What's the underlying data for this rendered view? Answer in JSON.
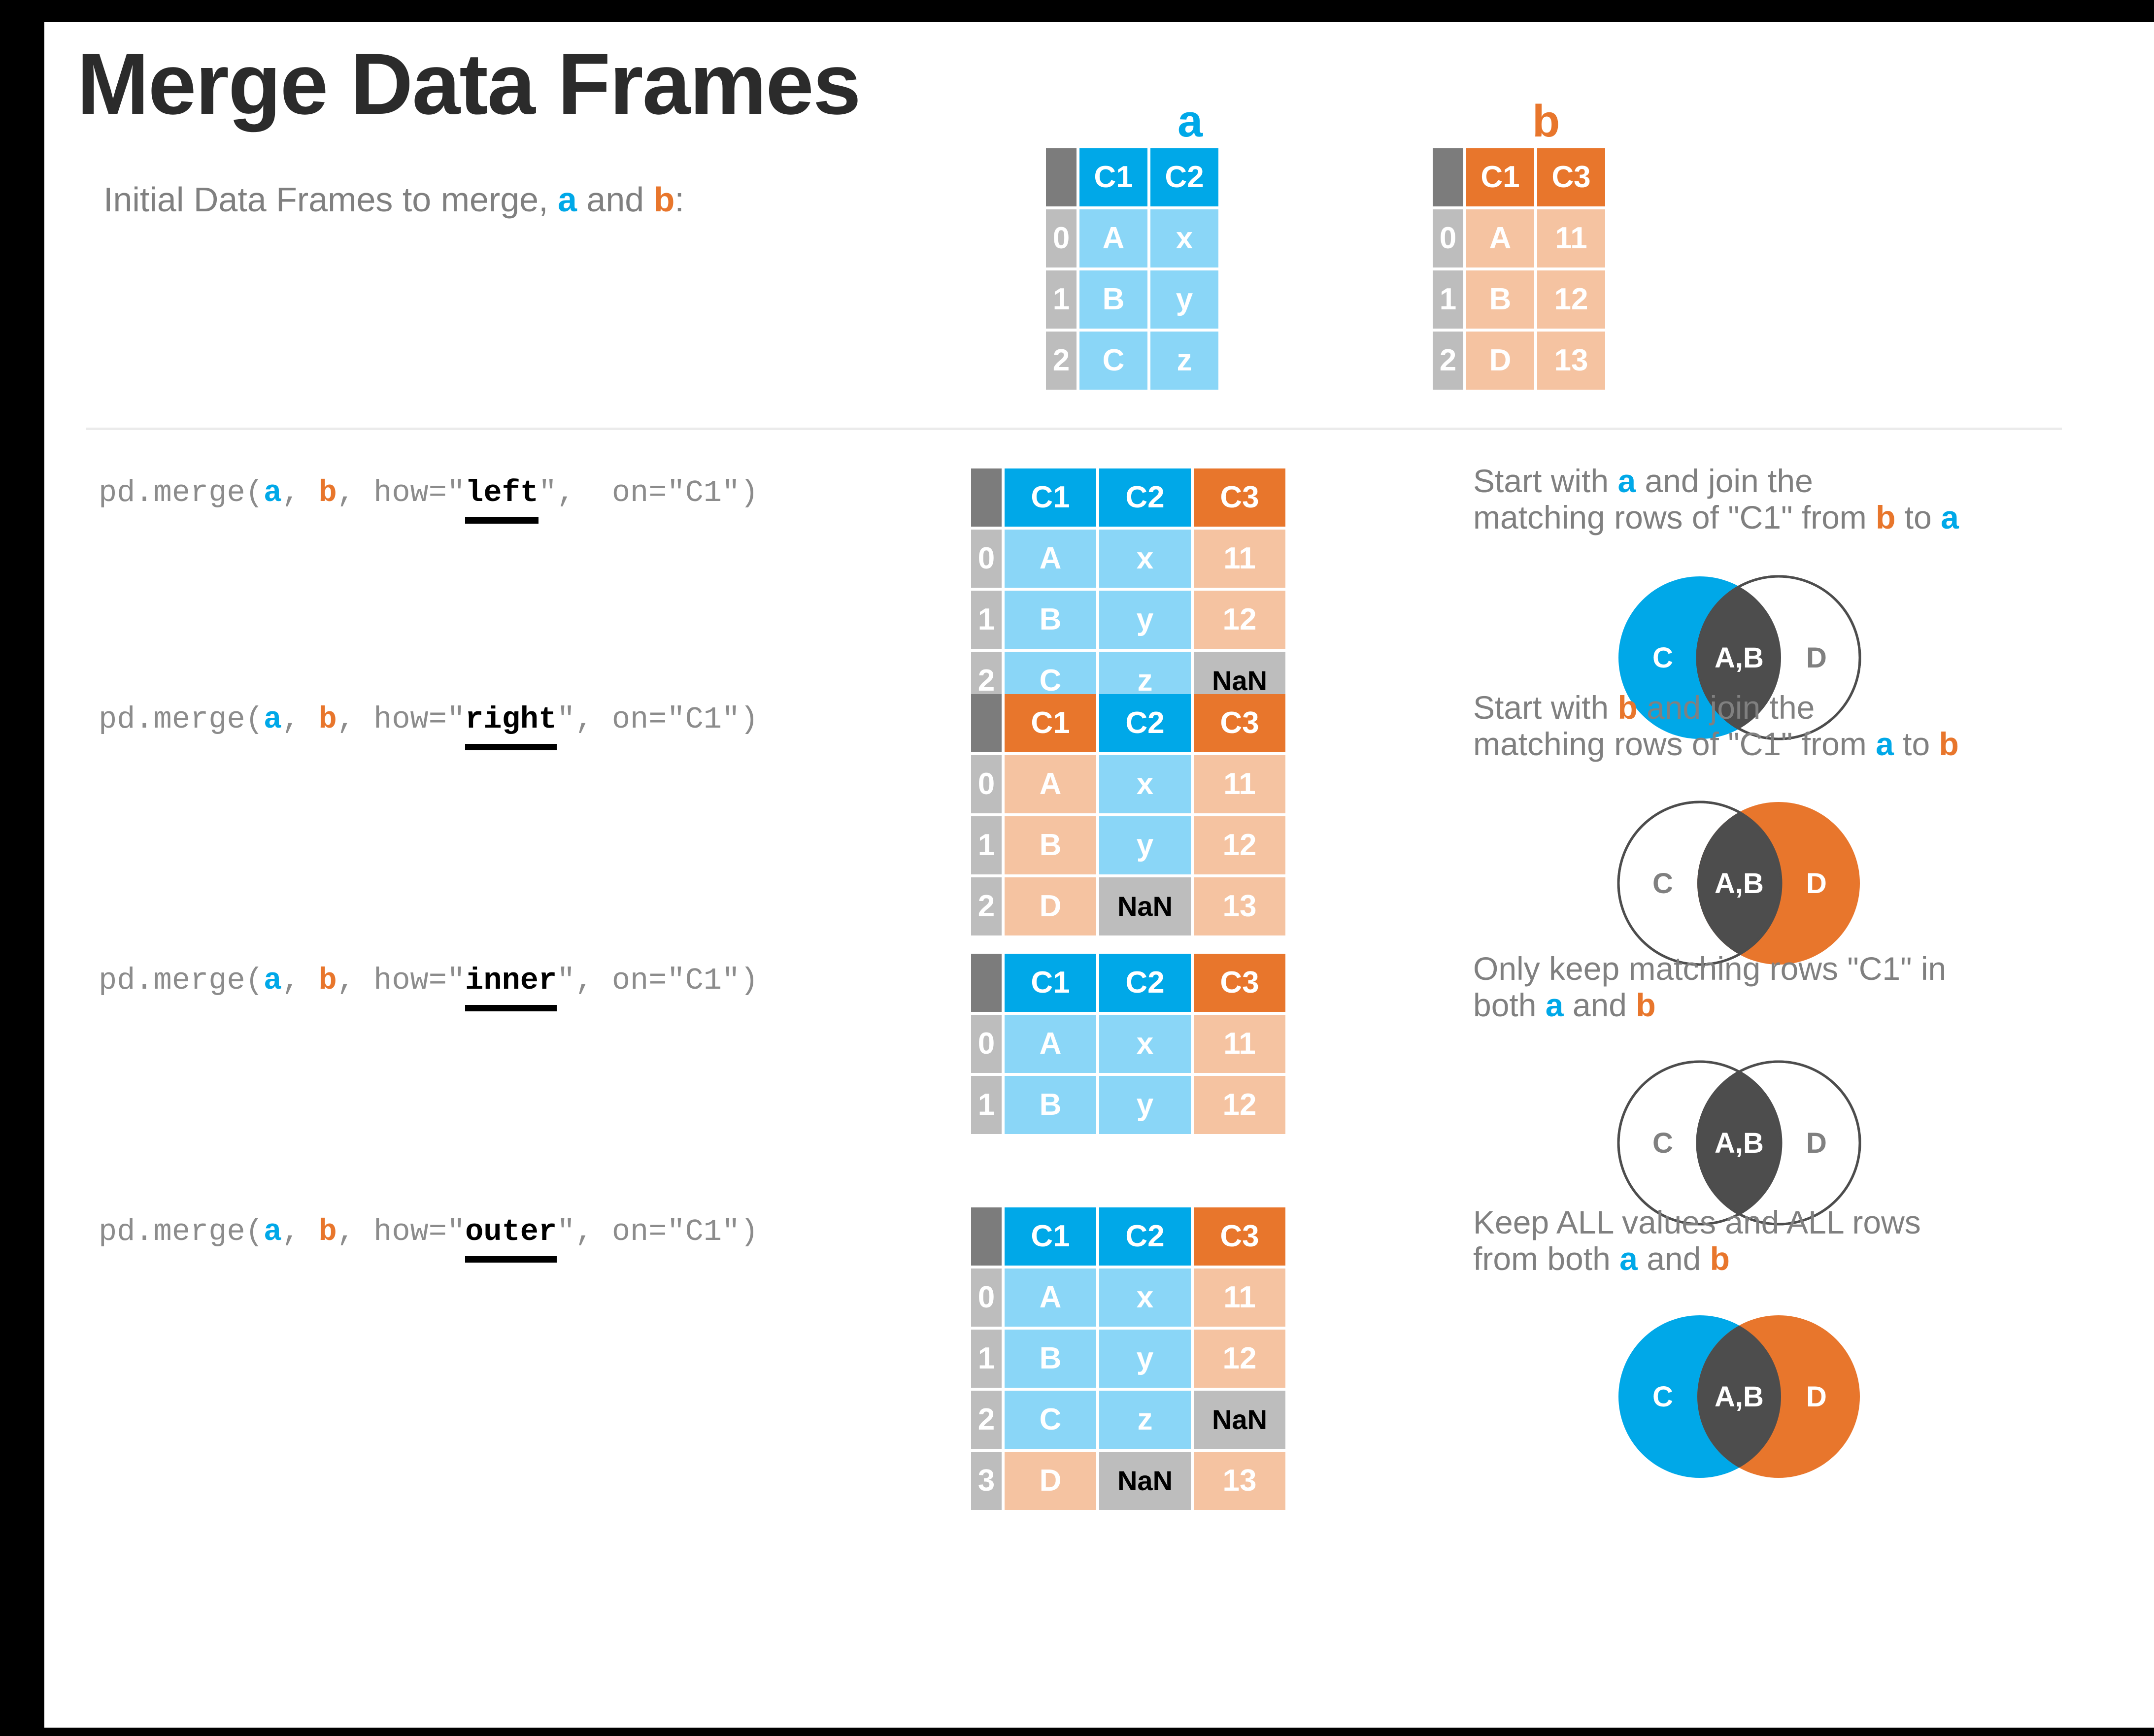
{
  "page": {
    "title": "Merge Data Frames",
    "intro_prefix": "Initial Data Frames to merge, ",
    "intro_a": "a",
    "intro_and": " and ",
    "intro_b": "b",
    "intro_suffix": ":"
  },
  "colors": {
    "blue": "#00a8e8",
    "blue_light": "#8ad6f7",
    "orange": "#e8762c",
    "orange_light": "#f5c3a1",
    "index_header": "#7c7c7c",
    "index_cell": "#bdbdbd",
    "nan_cell": "#bdbdbd",
    "dark_gray": "#4d4d4d",
    "text_gray": "#808080",
    "title_dark": "#2b2b2b"
  },
  "captions": {
    "a": "a",
    "b": "b"
  },
  "tables": {
    "a": {
      "name": "a",
      "headers": [
        "",
        "C1",
        "C2"
      ],
      "header_styles": [
        "idxh",
        "hb",
        "hb"
      ],
      "rows": [
        {
          "index": "0",
          "cells": [
            "A",
            "x"
          ],
          "styles": [
            "vb",
            "vb"
          ]
        },
        {
          "index": "1",
          "cells": [
            "B",
            "y"
          ],
          "styles": [
            "vb",
            "vb"
          ]
        },
        {
          "index": "2",
          "cells": [
            "C",
            "z"
          ],
          "styles": [
            "vb",
            "vb"
          ]
        }
      ]
    },
    "b": {
      "name": "b",
      "headers": [
        "",
        "C1",
        "C3"
      ],
      "header_styles": [
        "idxh",
        "ho",
        "ho"
      ],
      "rows": [
        {
          "index": "0",
          "cells": [
            "A",
            "11"
          ],
          "styles": [
            "vo",
            "vo"
          ]
        },
        {
          "index": "1",
          "cells": [
            "B",
            "12"
          ],
          "styles": [
            "vo",
            "vo"
          ]
        },
        {
          "index": "2",
          "cells": [
            "D",
            "13"
          ],
          "styles": [
            "vo",
            "vo"
          ]
        }
      ]
    },
    "left": {
      "headers": [
        "",
        "C1",
        "C2",
        "C3"
      ],
      "header_styles": [
        "idxh",
        "hb",
        "hb",
        "ho"
      ],
      "rows": [
        {
          "index": "0",
          "cells": [
            "A",
            "x",
            "11"
          ],
          "styles": [
            "vb",
            "vb",
            "vo"
          ]
        },
        {
          "index": "1",
          "cells": [
            "B",
            "y",
            "12"
          ],
          "styles": [
            "vb",
            "vb",
            "vo"
          ]
        },
        {
          "index": "2",
          "cells": [
            "C",
            "z",
            "NaN"
          ],
          "styles": [
            "vb",
            "vb",
            "nan"
          ]
        }
      ]
    },
    "right": {
      "headers": [
        "",
        "C1",
        "C2",
        "C3"
      ],
      "header_styles": [
        "idxh",
        "ho",
        "hb",
        "ho"
      ],
      "rows": [
        {
          "index": "0",
          "cells": [
            "A",
            "x",
            "11"
          ],
          "styles": [
            "vo",
            "vb",
            "vo"
          ]
        },
        {
          "index": "1",
          "cells": [
            "B",
            "y",
            "12"
          ],
          "styles": [
            "vo",
            "vb",
            "vo"
          ]
        },
        {
          "index": "2",
          "cells": [
            "D",
            "NaN",
            "13"
          ],
          "styles": [
            "vo",
            "nan",
            "vo"
          ]
        }
      ]
    },
    "inner": {
      "headers": [
        "",
        "C1",
        "C2",
        "C3"
      ],
      "header_styles": [
        "idxh",
        "hb",
        "hb",
        "ho"
      ],
      "rows": [
        {
          "index": "0",
          "cells": [
            "A",
            "x",
            "11"
          ],
          "styles": [
            "vb",
            "vb",
            "vo"
          ]
        },
        {
          "index": "1",
          "cells": [
            "B",
            "y",
            "12"
          ],
          "styles": [
            "vb",
            "vb",
            "vo"
          ]
        }
      ]
    },
    "outer": {
      "headers": [
        "",
        "C1",
        "C2",
        "C3"
      ],
      "header_styles": [
        "idxh",
        "hb",
        "hb",
        "ho"
      ],
      "rows": [
        {
          "index": "0",
          "cells": [
            "A",
            "x",
            "11"
          ],
          "styles": [
            "vb",
            "vb",
            "vo"
          ]
        },
        {
          "index": "1",
          "cells": [
            "B",
            "y",
            "12"
          ],
          "styles": [
            "vb",
            "vb",
            "vo"
          ]
        },
        {
          "index": "2",
          "cells": [
            "C",
            "z",
            "NaN"
          ],
          "styles": [
            "vb",
            "vb",
            "nan"
          ]
        },
        {
          "index": "3",
          "cells": [
            "D",
            "NaN",
            "13"
          ],
          "styles": [
            "vo",
            "nan",
            "vo"
          ]
        }
      ]
    }
  },
  "sections": [
    {
      "id": "left",
      "code": {
        "before": "pd.merge(",
        "arg_a": "a",
        "sep1": ", ",
        "arg_b": "b",
        "mid": ", how=\"",
        "keyword": "left",
        "after": "\",  on=\"C1\")"
      },
      "description": {
        "line1_pre": "Start with ",
        "line1_a": "a",
        "line1_post": " and join the",
        "line2_pre": "matching rows of \"C1\" from ",
        "line2_b": "b",
        "line2_mid": " to ",
        "line2_a": "a"
      },
      "venn": {
        "left_fill": "#00a8e8",
        "right_fill": "#ffffff",
        "overlap_fill": "#4d4d4d",
        "left_stroke": "none",
        "right_stroke": "#4d4d4d",
        "left_label": "C",
        "center_label": "A,B",
        "right_label": "D",
        "left_label_color": "#ffffff",
        "center_label_color": "#ffffff",
        "right_label_color": "#808080"
      }
    },
    {
      "id": "right",
      "code": {
        "before": "pd.merge(",
        "arg_a": "a",
        "sep1": ", ",
        "arg_b": "b",
        "mid": ", how=\"",
        "keyword": "right",
        "after": "\", on=\"C1\")"
      },
      "description": {
        "line1_pre": "Start with ",
        "line1_a": "b",
        "line1_post": " and join the",
        "line2_pre": "matching rows of \"C1\" from ",
        "line2_b": "a",
        "line2_mid": " to ",
        "line2_a": "b"
      },
      "venn": {
        "left_fill": "#ffffff",
        "right_fill": "#e8762c",
        "overlap_fill": "#4d4d4d",
        "left_stroke": "#4d4d4d",
        "right_stroke": "none",
        "left_label": "C",
        "center_label": "A,B",
        "right_label": "D",
        "left_label_color": "#808080",
        "center_label_color": "#ffffff",
        "right_label_color": "#ffffff"
      }
    },
    {
      "id": "inner",
      "code": {
        "before": "pd.merge(",
        "arg_a": "a",
        "sep1": ", ",
        "arg_b": "b",
        "mid": ", how=\"",
        "keyword": "inner",
        "after": "\", on=\"C1\")"
      },
      "description": {
        "line1_pre": "Only keep matching rows \"C1\" in",
        "line1_a": "",
        "line1_post": "",
        "line2_pre": "both ",
        "line2_b": "a",
        "line2_mid": " and ",
        "line2_a": "b"
      },
      "venn": {
        "left_fill": "#ffffff",
        "right_fill": "#ffffff",
        "overlap_fill": "#4d4d4d",
        "left_stroke": "#4d4d4d",
        "right_stroke": "#4d4d4d",
        "left_label": "C",
        "center_label": "A,B",
        "right_label": "D",
        "left_label_color": "#808080",
        "center_label_color": "#ffffff",
        "right_label_color": "#808080"
      }
    },
    {
      "id": "outer",
      "code": {
        "before": "pd.merge(",
        "arg_a": "a",
        "sep1": ", ",
        "arg_b": "b",
        "mid": ", how=\"",
        "keyword": "outer",
        "after": "\", on=\"C1\")"
      },
      "description": {
        "line1_pre": "Keep ALL values and ALL rows",
        "line1_a": "",
        "line1_post": "",
        "line2_pre": "from both ",
        "line2_b": "a",
        "line2_mid": " and ",
        "line2_a": "b"
      },
      "venn": {
        "left_fill": "#00a8e8",
        "right_fill": "#e8762c",
        "overlap_fill": "#4d4d4d",
        "left_stroke": "none",
        "right_stroke": "none",
        "left_label": "C",
        "center_label": "A,B",
        "right_label": "D",
        "left_label_color": "#ffffff",
        "center_label_color": "#ffffff",
        "right_label_color": "#ffffff"
      }
    }
  ]
}
